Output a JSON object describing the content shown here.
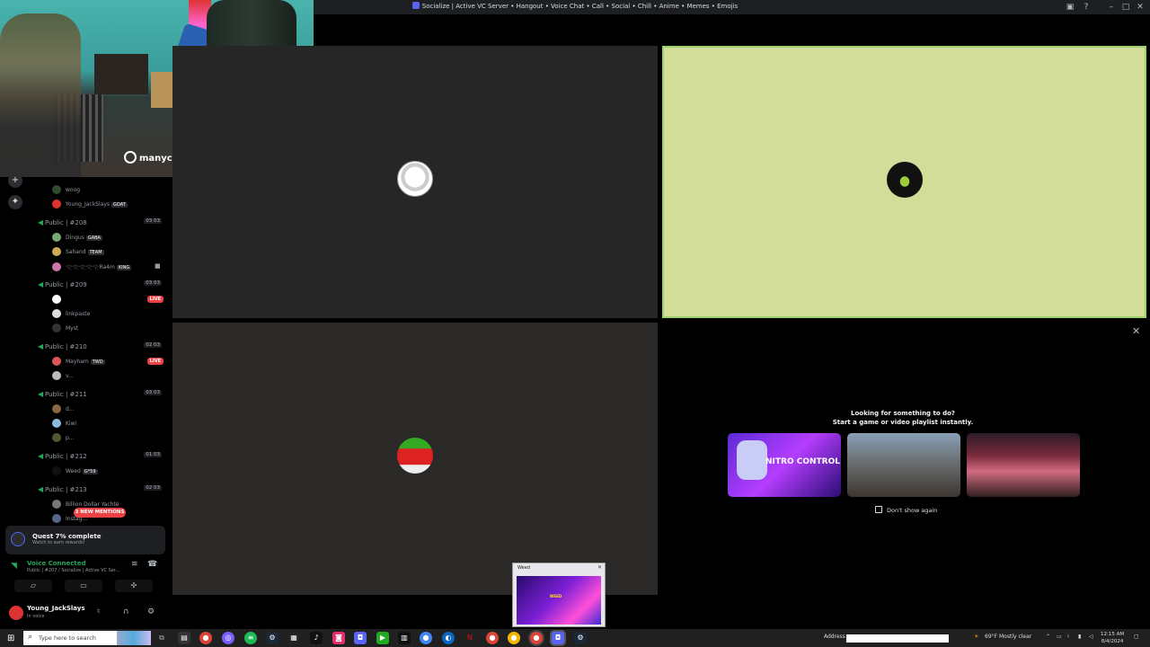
{
  "window": {
    "title": "Socialize | Active VC Server • Hangout • Voice Chat • Call • Social • Chill • Anime • Memes • Emojis",
    "icons": [
      "inbox-icon",
      "help-icon",
      "minimize-icon",
      "maximize-icon",
      "close-icon"
    ]
  },
  "webcam": {
    "overlay_logo": "manycam"
  },
  "rail": [
    "add-server-icon",
    "discover-icon"
  ],
  "channels": {
    "top_members": [
      {
        "name": "woog",
        "tag": ""
      },
      {
        "name": "Young_JackSlays",
        "tag": "GOAT"
      }
    ],
    "groups": [
      {
        "name": "Public | #208",
        "count": "03 03",
        "members": [
          {
            "name": "Dingus",
            "tag": "GABA"
          },
          {
            "name": "Sahand",
            "tag": "TEAM"
          },
          {
            "name": "𓂀𓂀𓂀𓂀𓂀Ra4m",
            "tag": "KING"
          }
        ]
      },
      {
        "name": "Public | #209",
        "count": "03 03",
        "members": [
          {
            "name": "",
            "tag": ""
          },
          {
            "name": "linkpaste",
            "tag": ""
          },
          {
            "name": "Myst",
            "tag": ""
          }
        ]
      },
      {
        "name": "Public | #210",
        "count": "02 03",
        "members": [
          {
            "name": "Mayham",
            "tag": "TWD"
          },
          {
            "name": "v...",
            "tag": ""
          }
        ]
      },
      {
        "name": "Public | #211",
        "count": "03 03",
        "members": [
          {
            "name": "d...",
            "tag": ""
          },
          {
            "name": "Kiwi",
            "tag": ""
          },
          {
            "name": "p...",
            "tag": ""
          }
        ]
      },
      {
        "name": "Public | #212",
        "count": "01 03",
        "members": [
          {
            "name": "Weed",
            "tag": "G*59"
          }
        ]
      },
      {
        "name": "Public | #213",
        "count": "02 03",
        "members": [
          {
            "name": "Billion Dollar Yachté",
            "tag": ""
          },
          {
            "name": "Instag...",
            "tag": ""
          }
        ]
      }
    ],
    "live_label": "LIVE",
    "mentions": "3 NEW MENTIONS"
  },
  "quest": {
    "title": "Quest 7% complete",
    "subtitle": "Watch to earn rewards!"
  },
  "voice": {
    "status": "Voice Connected",
    "channel": "Public | #207 / Socialize | Active VC Ser..."
  },
  "user": {
    "name": "Young_JackSlays",
    "status": "In voice"
  },
  "activity": {
    "heading_1": "Looking for something to do?",
    "heading_2": "Start a game or video playlist instantly.",
    "card_1": "NITRO CONTROL",
    "dont_show": "Don't show again"
  },
  "preview": {
    "title": "Weed",
    "thumb_text": "WEED"
  },
  "taskbar": {
    "search_placeholder": "Type here to search",
    "address_label": "Address",
    "weather": "69°F  Mostly clear",
    "time": "12:15 AM",
    "date": "8/4/2024"
  }
}
